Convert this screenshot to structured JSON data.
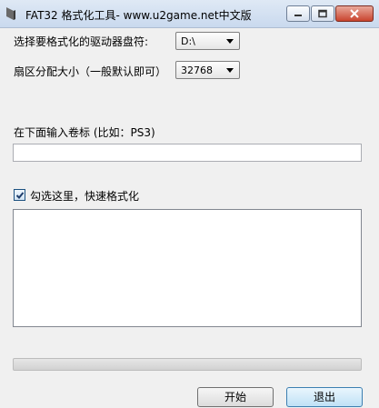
{
  "window": {
    "title": "FAT32 格式化工具- www.u2game.net中文版"
  },
  "drive": {
    "label": "选择要格式化的驱动器盘符:",
    "value": "D:\\"
  },
  "cluster": {
    "label": "扇区分配大小（一般默认即可）",
    "value": "32768"
  },
  "volume": {
    "label": "在下面输入卷标 (比如：PS3)",
    "value": ""
  },
  "quick_format": {
    "label": "勾选这里，快速格式化",
    "checked": true
  },
  "log": {
    "value": ""
  },
  "progress": {
    "fraction": 0
  },
  "buttons": {
    "start": "开始",
    "exit": "退出"
  }
}
